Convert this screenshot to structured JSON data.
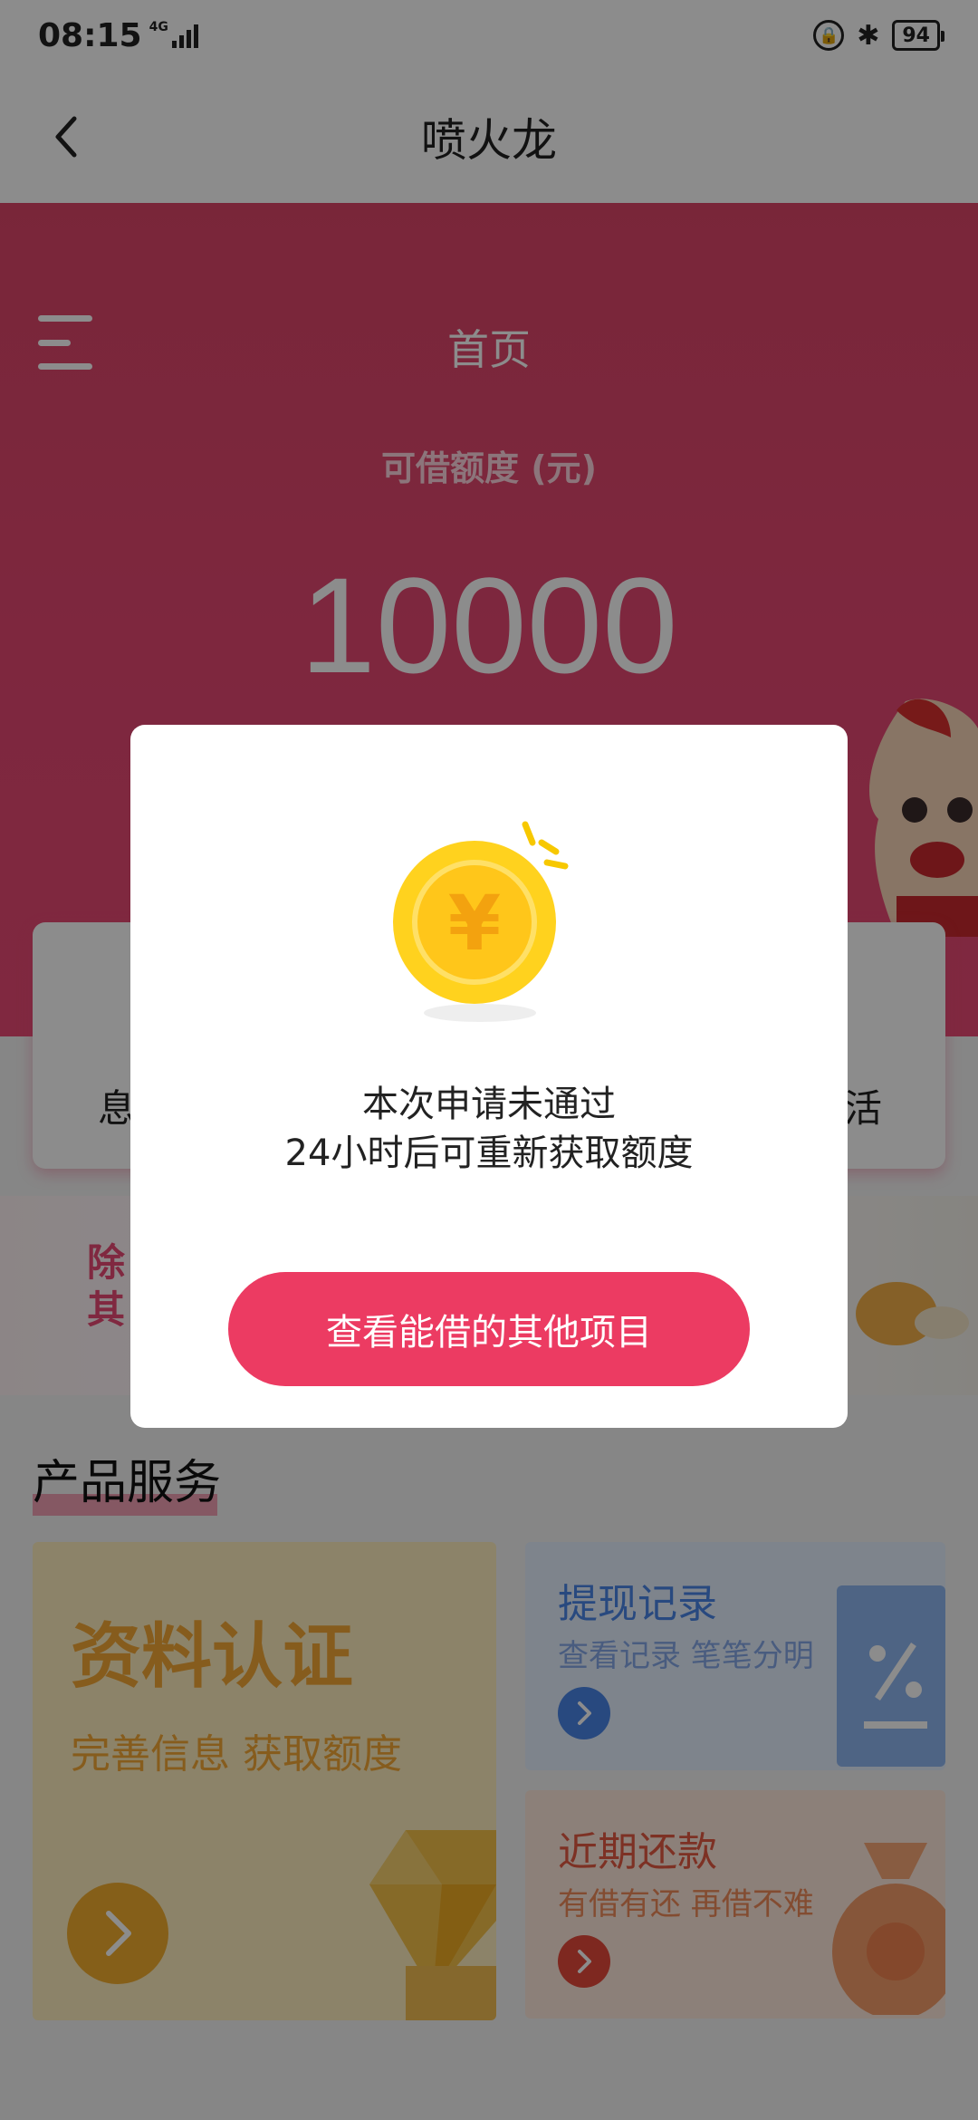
{
  "status_bar": {
    "time": "08:15",
    "network": "4G",
    "battery": "94"
  },
  "nav": {
    "title": "喷火龙"
  },
  "hero": {
    "home_label": "首页",
    "limit_label": "可借额度 (元)",
    "limit_value": "10000"
  },
  "feature_card": {
    "left_text": "息",
    "right_text": "活"
  },
  "banner": {
    "line1": "除",
    "line2": "其"
  },
  "services": {
    "title": "产品服务",
    "cards": [
      {
        "title": "资料认证",
        "subtitle": "完善信息 获取额度",
        "icon": "diamond-icon",
        "color": "#f4a836"
      },
      {
        "title": "提现记录",
        "subtitle": "查看记录 笔笔分明",
        "icon": "document-percent-icon",
        "color": "#4a86e8"
      },
      {
        "title": "近期还款",
        "subtitle": "有借有还 再借不难",
        "icon": "money-bag-icon",
        "color": "#e45a43"
      }
    ]
  },
  "dialog": {
    "icon": "yen-coin-icon",
    "message_line1": "本次申请未通过",
    "message_line2": "24小时后可重新获取额度",
    "action_label": "查看能借的其他项目"
  },
  "colors": {
    "brand": "#e94a75",
    "action": "#ec3b62"
  }
}
